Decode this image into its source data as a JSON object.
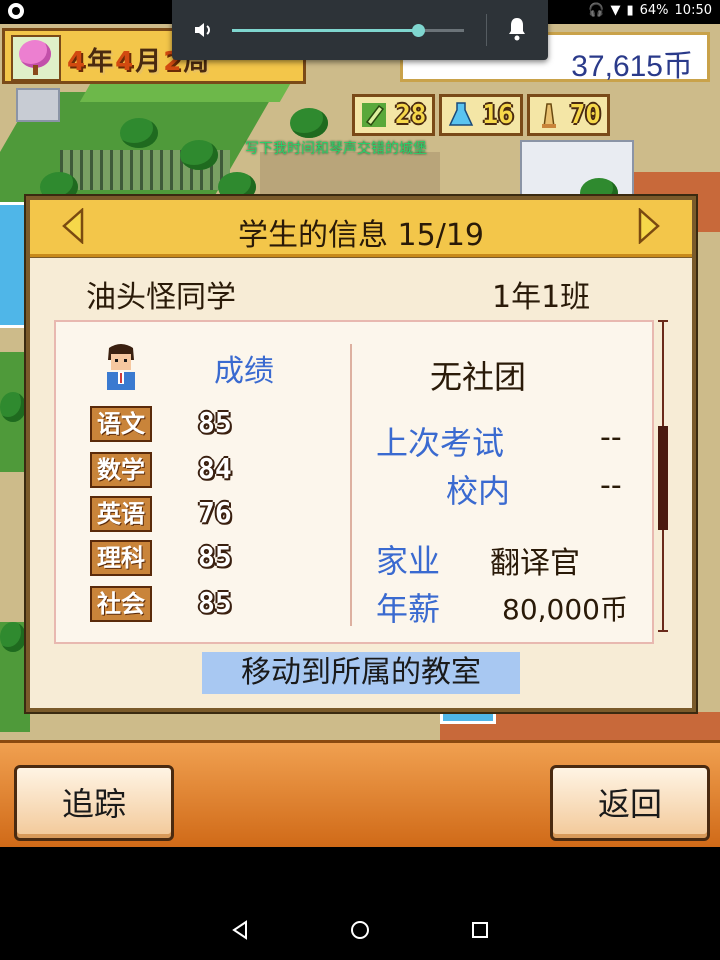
{
  "status_bar": {
    "battery": "64%",
    "time": "10:50"
  },
  "volume": {
    "level": 0.8
  },
  "hud": {
    "date": {
      "year": "4",
      "year_unit": "年",
      "month": "4",
      "month_unit": "月",
      "week": "2",
      "week_unit": "周"
    },
    "money": "37,615币",
    "stats": [
      "28",
      "16",
      "70"
    ]
  },
  "world": {
    "caption": "写下我时间和琴声交错的城堡"
  },
  "dialog": {
    "title": "学生的信息 15/19",
    "student_name": "油头怪同学",
    "student_class": "1年1班",
    "grades_label": "成绩",
    "subjects": [
      {
        "name": "语文",
        "score": "85"
      },
      {
        "name": "数学",
        "score": "84"
      },
      {
        "name": "英语",
        "score": "76"
      },
      {
        "name": "理科",
        "score": "85"
      },
      {
        "name": "社会",
        "score": "85"
      }
    ],
    "club": "无社团",
    "last_exam_label": "上次考试",
    "last_exam_value": "--",
    "school_label": "校内",
    "school_value": "--",
    "family_job_label": "家业",
    "family_job_value": "翻译官",
    "salary_label": "年薪",
    "salary_value": "80,000币",
    "move_button": "移动到所属的教室"
  },
  "bottom": {
    "track_button": "追踪",
    "back_button": "返回"
  },
  "colors": {
    "accent_blue": "#3a6ad0",
    "header_gold": "#f3c64a",
    "money_blue": "#2a3a8a"
  }
}
